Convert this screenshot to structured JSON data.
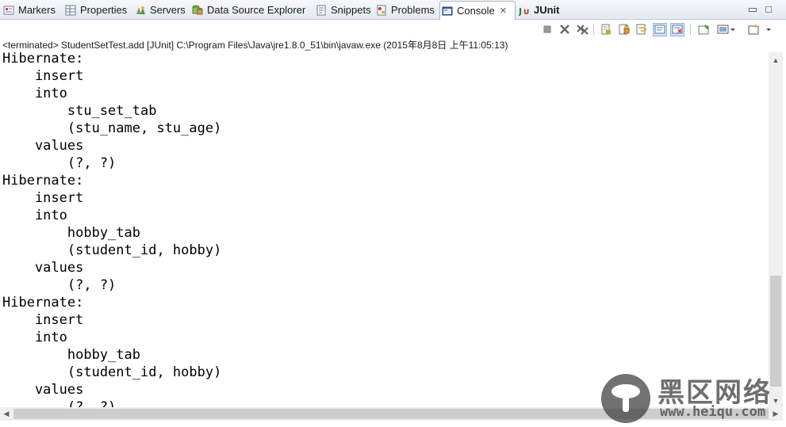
{
  "tabs": [
    {
      "label": "Markers",
      "icon": "markers-icon",
      "active": false
    },
    {
      "label": "Properties",
      "icon": "properties-icon",
      "active": false
    },
    {
      "label": "Servers",
      "icon": "servers-icon",
      "active": false
    },
    {
      "label": "Data Source Explorer",
      "icon": "data-source-icon",
      "active": false
    },
    {
      "label": "Snippets",
      "icon": "snippets-icon",
      "active": false
    },
    {
      "label": "Problems",
      "icon": "problems-icon",
      "active": false
    },
    {
      "label": "Console",
      "icon": "console-icon",
      "active": true,
      "close": "✕"
    },
    {
      "label": "JUnit",
      "icon": "junit-icon",
      "active": false
    }
  ],
  "window_controls": {
    "minimize": "▭",
    "maximize": "□"
  },
  "toolbar_icons": [
    "terminate-icon",
    "remove-launch-icon",
    "remove-all-terminated-icon",
    "clear-console-icon",
    "scroll-lock-icon",
    "word-wrap-icon",
    "show-on-stdout-icon",
    "show-on-stderr-icon",
    "pin-console-icon",
    "display-selected-console-icon",
    "open-console-icon"
  ],
  "status_text": "<terminated> StudentSetTest.add [JUnit] C:\\Program Files\\Java\\jre1.8.0_51\\bin\\javaw.exe (2015年8月8日 上午11:05:13)",
  "console_lines": [
    "Hibernate:",
    "    insert",
    "    into",
    "        stu_set_tab",
    "        (stu_name, stu_age)",
    "    values",
    "        (?, ?)",
    "Hibernate:",
    "    insert",
    "    into",
    "        hobby_tab",
    "        (student_id, hobby)",
    "    values",
    "        (?, ?)",
    "Hibernate:",
    "    insert",
    "    into",
    "        hobby_tab",
    "        (student_id, hobby)",
    "    values",
    "        (?, ?)"
  ],
  "scrollbar": {
    "up": "▲",
    "down": "▼",
    "left": "◀",
    "right": "▶"
  },
  "watermark": {
    "text": "黑区网络",
    "url": "www.heiqu.com"
  },
  "colors": {
    "active_tab_border": "#a7b4c6",
    "tab_bar": "#e3e9f2",
    "pressed_button": "#d5e4f5"
  }
}
